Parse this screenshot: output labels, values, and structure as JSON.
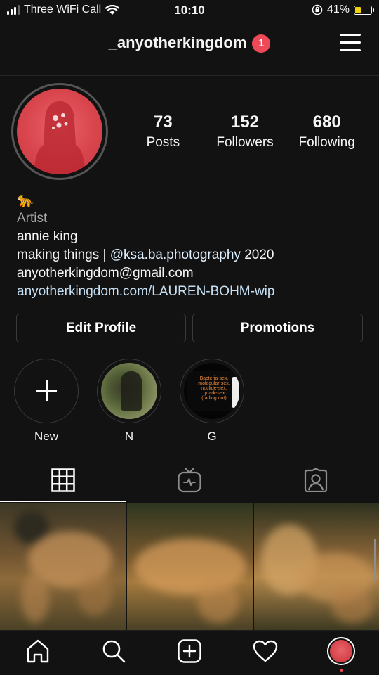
{
  "status_bar": {
    "carrier": "Three WiFi Call",
    "time": "10:10",
    "battery_percent": "41%",
    "battery_level": 0.41
  },
  "header": {
    "username": "_anyotherkingdom",
    "notification_count": "1"
  },
  "profile": {
    "stats": [
      {
        "value": "73",
        "label": "Posts"
      },
      {
        "value": "152",
        "label": "Followers"
      },
      {
        "value": "680",
        "label": "Following"
      }
    ],
    "bio": {
      "emoji": "🐆",
      "category": "Artist",
      "name": "annie king",
      "line_prefix": "making things | ",
      "mention": "@ksa.ba.photography",
      "line_suffix": " 2020",
      "email": "anyotherkingdom@gmail.com",
      "website": "anyotherkingdom.com/LAUREN-BOHM-wip"
    },
    "buttons": {
      "edit": "Edit Profile",
      "promotions": "Promotions"
    }
  },
  "highlights": [
    {
      "label": "New",
      "icon": "plus-icon"
    },
    {
      "label": "N"
    },
    {
      "label": "G",
      "cover_text": "Bacteria-sex,\nmolecular-sex,\nnuclide-sex,\nquark-sex\n(fading out)"
    }
  ],
  "tabs": [
    {
      "icon": "grid-icon",
      "active": true
    },
    {
      "icon": "igtv-icon",
      "active": false
    },
    {
      "icon": "tagged-icon",
      "active": false
    }
  ],
  "bottom_nav": [
    {
      "icon": "home-icon"
    },
    {
      "icon": "search-icon"
    },
    {
      "icon": "new-post-icon"
    },
    {
      "icon": "heart-icon"
    },
    {
      "icon": "profile-avatar-icon"
    }
  ],
  "colors": {
    "background": "#121212",
    "notification_badge": "#ed4956",
    "battery_fill": "#f1d30a",
    "avatar_red": "#d9454d"
  }
}
